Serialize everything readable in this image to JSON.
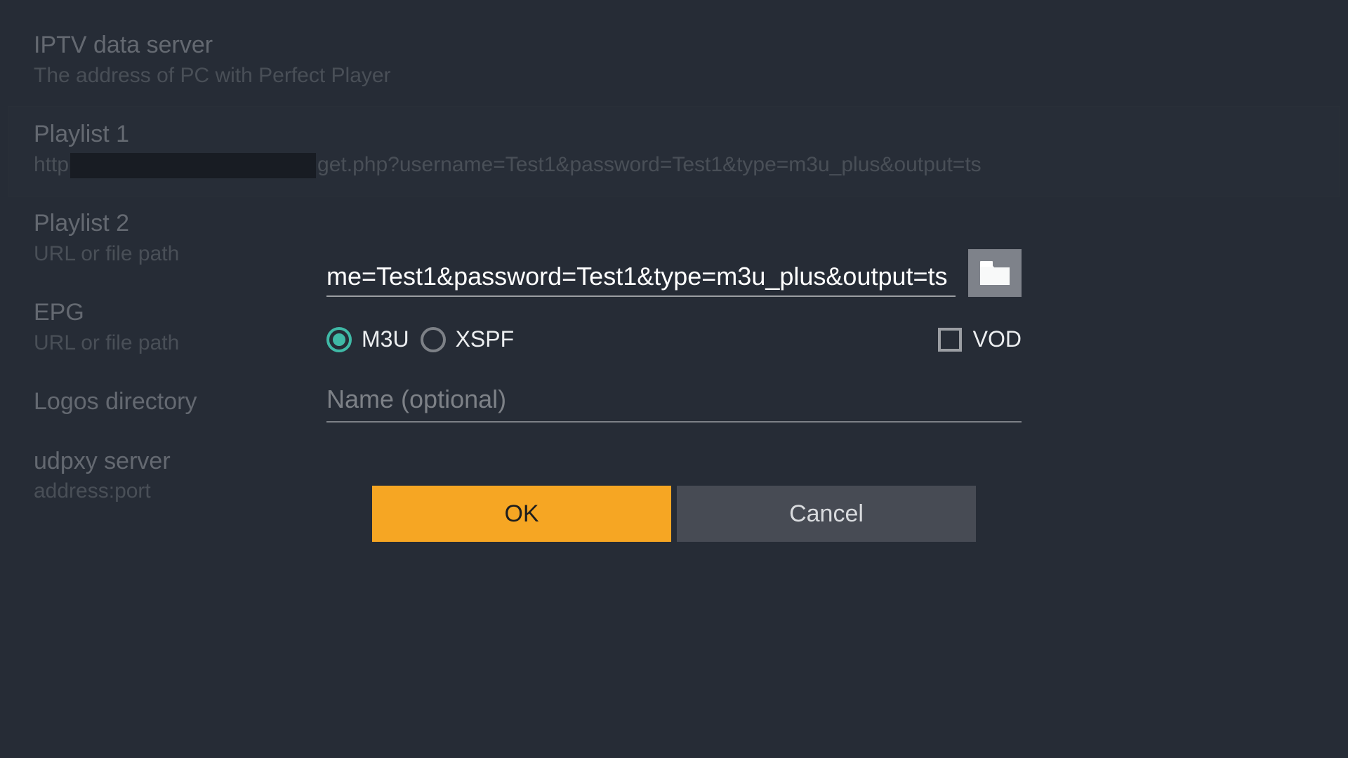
{
  "settings": {
    "iptv": {
      "title": "IPTV data server",
      "sub": "The address of PC with Perfect Player"
    },
    "playlist1": {
      "title": "Playlist 1",
      "sub_prefix": "http",
      "sub_suffix": "get.php?username=Test1&password=Test1&type=m3u_plus&output=ts"
    },
    "playlist2": {
      "title": "Playlist 2",
      "sub": "URL or file path"
    },
    "epg": {
      "title": "EPG",
      "sub": "URL or file path"
    },
    "logos": {
      "title": "Logos directory"
    },
    "udpxy": {
      "title": "udpxy server",
      "sub": "address:port"
    }
  },
  "dialog": {
    "url_value": "me=Test1&password=Test1&type=m3u_plus&output=ts",
    "radio_m3u": "M3U",
    "radio_xspf": "XSPF",
    "checkbox_vod": "VOD",
    "name_placeholder": "Name (optional)",
    "ok": "OK",
    "cancel": "Cancel"
  }
}
